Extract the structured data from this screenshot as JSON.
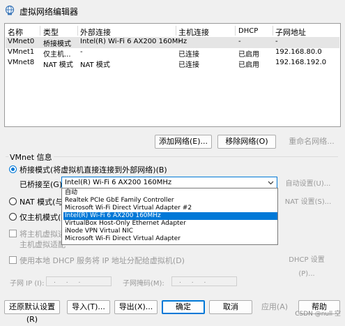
{
  "window": {
    "title": "虚拟网络编辑器"
  },
  "table": {
    "headers": [
      "名称",
      "类型",
      "外部连接",
      "主机连接",
      "DHCP",
      "子网地址"
    ],
    "rows": [
      [
        "VMnet0",
        "桥接模式",
        "Intel(R) Wi-Fi 6 AX200 160MHz",
        "-",
        "-",
        "-"
      ],
      [
        "VMnet1",
        "仅主机...",
        "-",
        "已连接",
        "已启用",
        "192.168.80.0"
      ],
      [
        "VMnet8",
        "NAT 模式",
        "NAT 模式",
        "已连接",
        "已启用",
        "192.168.192.0"
      ]
    ]
  },
  "net_buttons": {
    "add": "添加网络(E)...",
    "remove": "移除网络(O)",
    "rename": "重命名网络..."
  },
  "vmnet_info": {
    "legend": "VMnet 信息",
    "bridge_label": "桥接模式(将虚拟机直接连接到外部网络)(B)",
    "bridged_to_label": "已桥接至(G):",
    "bridged_to_value": "Intel(R) Wi-Fi 6 AX200 160MHz",
    "auto_settings": "自动设置(U)...",
    "nat_label": "NAT 模式(与虚",
    "nat_settings": "NAT 设置(S)...",
    "hostonly_label": "仅主机模式(在",
    "connect_host_label": "将主机虚拟适",
    "host_adapter_label": "主机虚拟适配",
    "dhcp_label": "使用本地 DHCP 服务将 IP 地址分配给虚拟机(D)",
    "dhcp_settings": "DHCP 设置(P)...",
    "subnet_ip_label": "子网 IP (I):",
    "subnet_mask_label": "子网掩码(M):",
    "ip_placeholder": ". . .",
    "mask_placeholder": ". . ."
  },
  "dropdown_options": [
    "自动",
    "Realtek PCIe GbE Family Controller",
    "Microsoft Wi-Fi Direct Virtual Adapter #2",
    "Intel(R) Wi-Fi 6 AX200 160MHz",
    "VirtualBox Host-Only Ethernet Adapter",
    "iNode VPN Virtual NIC",
    "Microsoft Wi-Fi Direct Virtual Adapter"
  ],
  "dropdown_selected_index": 3,
  "bottom_buttons": {
    "restore": "还原默认设置(R)",
    "import": "导入(T)...",
    "export": "导出(X)...",
    "ok": "确定",
    "cancel": "取消",
    "apply": "应用(A)",
    "help": "帮助"
  },
  "watermark": "CSDN @null 空",
  "colors": {
    "accent": "#0078d7",
    "selection": "#0078d7"
  }
}
